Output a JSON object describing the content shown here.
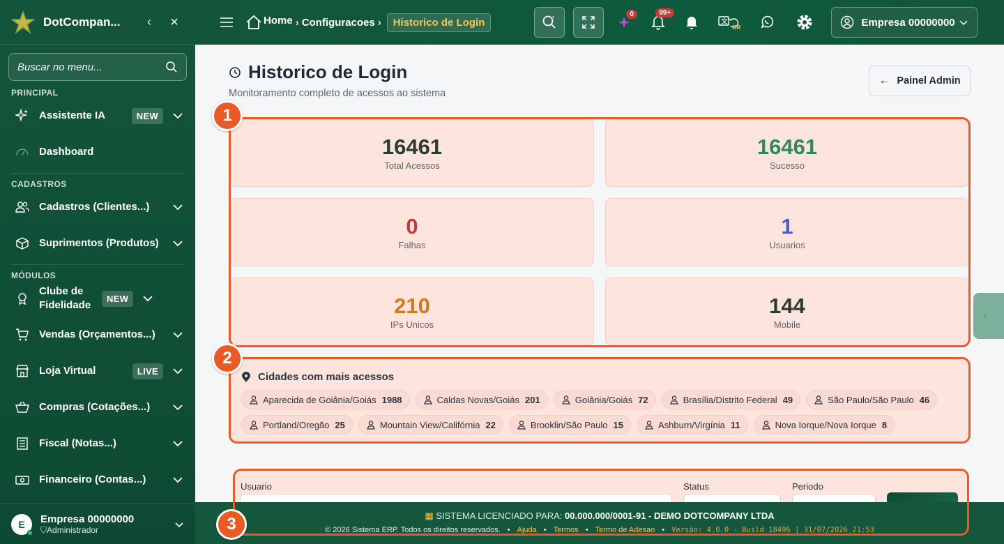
{
  "sidebar": {
    "brand": "DotCompan...",
    "search_placeholder": "Buscar no menu...",
    "sections": {
      "principal": "PRINCIPAL",
      "cadastros": "CADASTROS",
      "modulos": "MÓDULOS"
    },
    "items": [
      {
        "label": "Assistente IA",
        "badge": "NEW"
      },
      {
        "label": "Dashboard"
      },
      {
        "label": "Cadastros (Clientes...)"
      },
      {
        "label": "Suprimentos (Produtos)"
      },
      {
        "label": "Clube de Fidelidade",
        "badge": "NEW"
      },
      {
        "label": "Vendas (Orçamentos...)"
      },
      {
        "label": "Loja Virtual",
        "badge": "LIVE"
      },
      {
        "label": "Compras (Cotações...)"
      },
      {
        "label": "Fiscal (Notas...)"
      },
      {
        "label": "Financeiro (Contas...)"
      }
    ],
    "user": {
      "initial": "E",
      "name": "Empresa 00000000",
      "role": "Administrador"
    }
  },
  "topbar": {
    "breadcrumb": {
      "home": "Home",
      "parent": "Configuracoes",
      "current": "Historico de Login"
    },
    "badges": {
      "ai": "0",
      "notifications": "99+"
    },
    "lang": "BR",
    "company": "Empresa 00000000"
  },
  "page": {
    "title": "Historico de Login",
    "subtitle": "Monitoramento completo de acessos ao sistema",
    "admin_button": "Painel Admin"
  },
  "stats": [
    {
      "value": "16461",
      "label": "Total Acessos",
      "color": "#2d3b30"
    },
    {
      "value": "16461",
      "label": "Sucesso",
      "color": "#2f8a5a"
    },
    {
      "value": "0",
      "label": "Falhas",
      "color": "#c53a3a"
    },
    {
      "value": "1",
      "label": "Usuarios",
      "color": "#4a5bd0"
    },
    {
      "value": "210",
      "label": "IPs Unicos",
      "color": "#d07a1c"
    },
    {
      "value": "144",
      "label": "Mobile",
      "color": "#2d3b30"
    }
  ],
  "cities": {
    "title": "Cidades com mais acessos",
    "list": [
      {
        "name": "Aparecida de Goiânia/Goiás",
        "count": "1988"
      },
      {
        "name": "Caldas Novas/Goiás",
        "count": "201"
      },
      {
        "name": "Goiânia/Goiás",
        "count": "72"
      },
      {
        "name": "Brasília/Distrito Federal",
        "count": "49"
      },
      {
        "name": "São Paulo/São Paulo",
        "count": "46"
      },
      {
        "name": "Portland/Oregão",
        "count": "25"
      },
      {
        "name": "Mountain View/Califórnia",
        "count": "22"
      },
      {
        "name": "Brooklin/São Paulo",
        "count": "15"
      },
      {
        "name": "Ashburn/Virgínia",
        "count": "11"
      },
      {
        "name": "Nova Iorque/Nova Iorque",
        "count": "8"
      }
    ]
  },
  "filters": {
    "user_label": "Usuario",
    "status_label": "Status",
    "period_label": "Periodo"
  },
  "annotations": [
    "1",
    "2",
    "3"
  ],
  "footer": {
    "license_prefix": "SISTEMA LICENCIADO PARA:",
    "license_holder": "00.000.000/0001-91 - DEMO DOTCOMPANY LTDA",
    "copyright": "© 2026 Sistema ERP. Todos os direitos reservados.",
    "links": [
      "Ajuda",
      "Termos",
      "Termo de Adesao"
    ],
    "version": "Versão: 4.0.0 - Build 18496 | 31/07/2026 21:53"
  },
  "colors": {
    "primary": "#13553b",
    "highlight": "#ea5a25",
    "card": "#fde4dd",
    "accent": "#f5c451"
  }
}
